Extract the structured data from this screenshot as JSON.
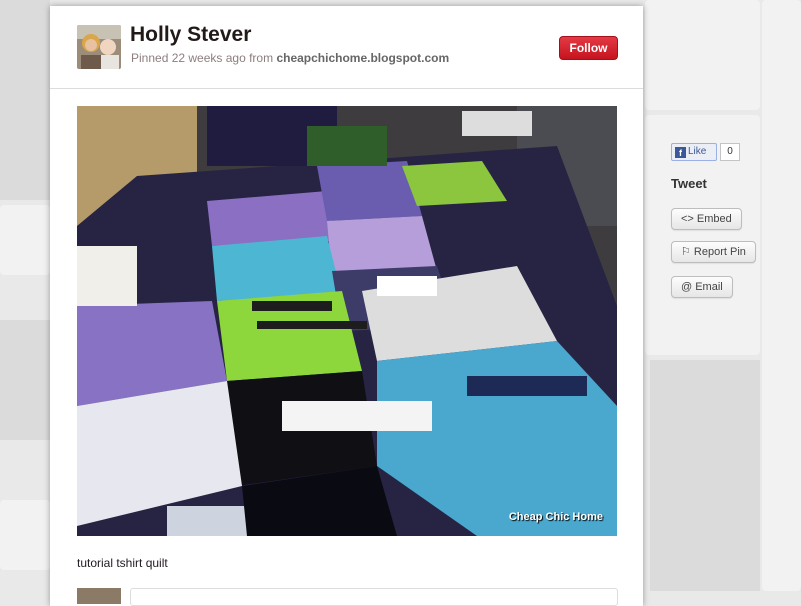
{
  "pin": {
    "user_name": "Holly Stever",
    "pinned_prefix": "Pinned 22 weeks ago from",
    "source": "cheapchichome.blogspot.com",
    "follow_label": "Follow",
    "watermark": "Cheap Chic Home",
    "description": "tutorial tshirt quilt"
  },
  "share": {
    "fb_like_label": "Like",
    "fb_count": "0",
    "tweet_label": "Tweet",
    "embed_label": "<> Embed",
    "report_label": "⚐ Report Pin",
    "email_label": "@ Email"
  },
  "colors": {
    "follow_button": "#cb2027",
    "overlay": "#e9e9e9"
  }
}
